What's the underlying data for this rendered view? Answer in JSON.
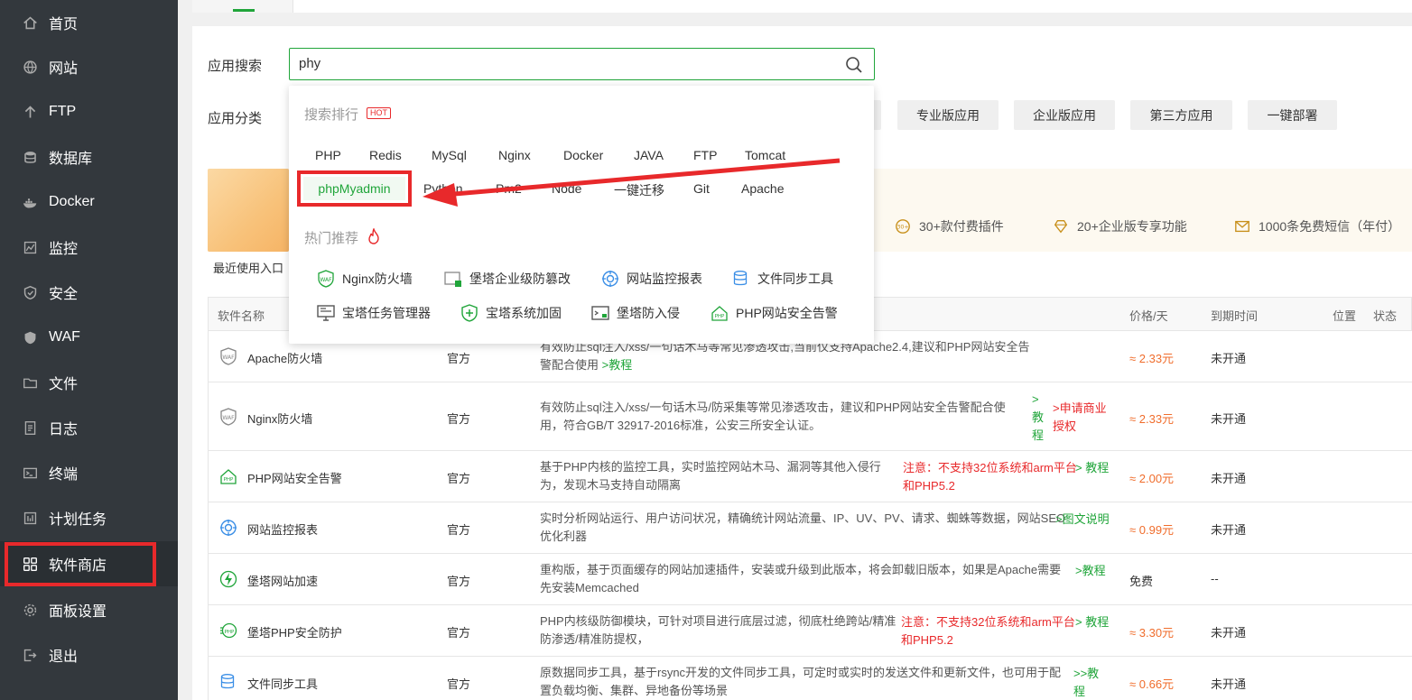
{
  "sidebar": {
    "items": [
      {
        "label": "首页",
        "icon": "home-icon"
      },
      {
        "label": "网站",
        "icon": "globe-icon"
      },
      {
        "label": "FTP",
        "icon": "ftp-icon"
      },
      {
        "label": "数据库",
        "icon": "database-icon"
      },
      {
        "label": "Docker",
        "icon": "docker-icon"
      },
      {
        "label": "监控",
        "icon": "monitor-icon"
      },
      {
        "label": "安全",
        "icon": "shield-icon"
      },
      {
        "label": "WAF",
        "icon": "waf-shield-icon"
      },
      {
        "label": "文件",
        "icon": "folder-icon"
      },
      {
        "label": "日志",
        "icon": "log-icon"
      },
      {
        "label": "终端",
        "icon": "terminal-icon"
      },
      {
        "label": "计划任务",
        "icon": "schedule-icon"
      },
      {
        "label": "软件商店",
        "icon": "app-store-icon",
        "active": true
      },
      {
        "label": "面板设置",
        "icon": "settings-icon"
      },
      {
        "label": "退出",
        "icon": "logout-icon"
      }
    ]
  },
  "search": {
    "label": "应用搜索",
    "value": "phy"
  },
  "category": {
    "label": "应用分类",
    "buttons": [
      "专业版应用",
      "企业版应用",
      "第三方应用",
      "一键部署"
    ]
  },
  "banner": {
    "features": [
      "30+款付费插件",
      "20+企业版专享功能",
      "1000条免费短信（年付）"
    ]
  },
  "recent_label": "最近使用入口",
  "table": {
    "headers": {
      "name": "软件名称",
      "price": "价格/天",
      "expire": "到期时间",
      "position": "位置",
      "status": "状态"
    },
    "rows": [
      {
        "name": "Apache防火墙",
        "icon": "waf-icon",
        "developer": "官方",
        "desc": "有效防止sql注入/xss/一句话木马等常见渗透攻击,当前仅支持Apache2.4,建议和PHP网站安全告警配合使用",
        "link": ">教程",
        "warn": "",
        "price": "≈ 2.33元",
        "expire": "未开通"
      },
      {
        "name": "Nginx防火墙",
        "icon": "waf-icon",
        "developer": "官方",
        "desc": "有效防止sql注入/xss/一句话木马/防采集等常见渗透攻击，建议和PHP网站安全告警配合使用，符合GB/T 32917-2016标准，公安三所安全认证。",
        "link": "> 教程",
        "warn": ">申请商业授权",
        "price": "≈ 2.33元",
        "expire": "未开通"
      },
      {
        "name": "PHP网站安全告警",
        "icon": "php-alert-icon",
        "developer": "官方",
        "desc": "基于PHP内核的监控工具，实时监控网站木马、漏洞等其他入侵行为，发现木马支持自动隔离",
        "link": "> 教程",
        "warn": "注意：不支持32位系统和arm平台和PHP5.2",
        "price": "≈ 2.00元",
        "expire": "未开通"
      },
      {
        "name": "网站监控报表",
        "icon": "site-monitor-icon",
        "developer": "官方",
        "desc": "实时分析网站运行、用户访问状况，精确统计网站流量、IP、UV、PV、请求、蜘蛛等数据，网站SEO优化利器",
        "link": ">图文说明",
        "warn": "",
        "price": "≈ 0.99元",
        "expire": "未开通"
      },
      {
        "name": "堡塔网站加速",
        "icon": "lightning-icon",
        "developer": "官方",
        "desc": "重构版，基于页面缓存的网站加速插件，安装或升级到此版本，将会卸载旧版本，如果是Apache需要先安装Memcached",
        "link": ">教程",
        "warn": "",
        "price": "免费",
        "expire": "--"
      },
      {
        "name": "堡塔PHP安全防护",
        "icon": "php-guard-icon",
        "developer": "官方",
        "desc": "PHP内核级防御模块，可针对项目进行底层过滤，彻底杜绝跨站/精准防渗透/精准防提权，",
        "link": "> 教程",
        "warn": "注意：不支持32位系统和arm平台和PHP5.2",
        "price": "≈ 3.30元",
        "expire": "未开通"
      },
      {
        "name": "文件同步工具",
        "icon": "sync-db-icon",
        "developer": "官方",
        "desc": "原数据同步工具，基于rsync开发的文件同步工具，可定时或实时的发送文件和更新文件，也可用于配置负载均衡、集群、异地备份等场景",
        "link": ">>教程",
        "warn": "",
        "price": "≈ 0.66元",
        "expire": "未开通"
      }
    ]
  },
  "dropdown": {
    "ranking_title": "搜索排行",
    "hot_badge": "HOT",
    "keywords_row1": [
      "PHP",
      "Redis",
      "MySql",
      "Nginx",
      "Docker",
      "JAVA",
      "FTP",
      "Tomcat"
    ],
    "keywords_row2": [
      "phpMyadmin",
      "Python",
      "Pm2",
      "Node",
      "一键迁移",
      "Git",
      "Apache"
    ],
    "recommend_title": "热门推荐",
    "recommend": [
      {
        "label": "Nginx防火墙",
        "icon": "waf-icon"
      },
      {
        "label": "堡塔企业级防篡改",
        "icon": "tamper-proof-icon"
      },
      {
        "label": "网站监控报表",
        "icon": "site-monitor-icon"
      },
      {
        "label": "文件同步工具",
        "icon": "sync-db-icon"
      },
      {
        "label": "宝塔任务管理器",
        "icon": "task-manager-icon"
      },
      {
        "label": "宝塔系统加固",
        "icon": "shield-plus-icon"
      },
      {
        "label": "堡塔防入侵",
        "icon": "anti-intrusion-icon"
      },
      {
        "label": "PHP网站安全告警",
        "icon": "php-alert-icon"
      }
    ]
  },
  "colors": {
    "accent": "#20a53a",
    "sidebar": "#33383d",
    "annotation": "#e8292b",
    "price": "#f06d2c"
  }
}
